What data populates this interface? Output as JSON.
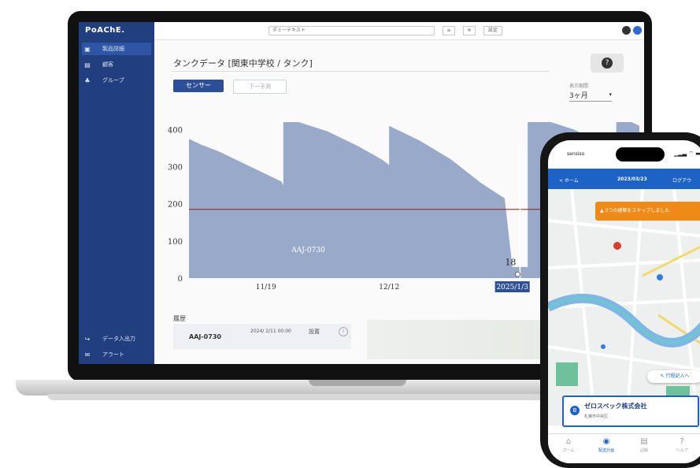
{
  "app": {
    "logo": "PoAChE.",
    "sidebar": {
      "items": [
        {
          "icon": "device-icon",
          "glyph": "▣",
          "label": "製品詳細",
          "active": true
        },
        {
          "icon": "building-icon",
          "glyph": "▤",
          "label": "顧客",
          "active": false
        },
        {
          "icon": "group-icon",
          "glyph": "♣",
          "label": "グループ",
          "active": false
        }
      ],
      "bottom": [
        {
          "icon": "import-icon",
          "glyph": "↪",
          "label": "データ入出力"
        },
        {
          "icon": "alert-icon",
          "glyph": "✉",
          "label": "アラート"
        }
      ]
    },
    "topbar": {
      "select": "ダミーテキスト",
      "buttons": [
        "≡",
        "※",
        "設定"
      ]
    },
    "title": "タンクデータ [関東中学校 / タンク]",
    "tabs": {
      "active": "センサー",
      "inactive": "下一予測"
    },
    "period": {
      "label": "表示期間",
      "value": "3ヶ月",
      "caret": "▾"
    },
    "history": {
      "label": "履歴",
      "row": {
        "id": "AAJ-0730",
        "date": "2024/ 2/11 00:00",
        "type": "設置",
        "info": "i"
      }
    }
  },
  "chart_data": {
    "type": "area",
    "y_ticks": [
      "400",
      "300",
      "200",
      "100",
      "0"
    ],
    "x_ticks": [
      "11/19",
      "12/12",
      "2025/1/3"
    ],
    "ylim": [
      0,
      420
    ],
    "threshold": 185,
    "series_label": "AAJ-0730",
    "cursor_value": "18",
    "points": [
      [
        0,
        375
      ],
      [
        3,
        360
      ],
      [
        8,
        340
      ],
      [
        14,
        310
      ],
      [
        20,
        280
      ],
      [
        24,
        260
      ],
      [
        24.5,
        250
      ],
      [
        24.5,
        430
      ],
      [
        28.5,
        430
      ],
      [
        36,
        395
      ],
      [
        44,
        355
      ],
      [
        50,
        320
      ],
      [
        52,
        305
      ],
      [
        52,
        410
      ],
      [
        60,
        370
      ],
      [
        68,
        320
      ],
      [
        76,
        255
      ],
      [
        82,
        215
      ],
      [
        84,
        30
      ],
      [
        88,
        30
      ],
      [
        88,
        430
      ],
      [
        94,
        430
      ],
      [
        100,
        400
      ],
      [
        106,
        370
      ],
      [
        110,
        345
      ],
      [
        111,
        330
      ],
      [
        111,
        430
      ],
      [
        112,
        430
      ],
      [
        115,
        420
      ],
      [
        117,
        410
      ]
    ],
    "x_range": [
      0,
      117
    ],
    "colors": {
      "area": "#99a9c9",
      "threshold": "#8b1a1a",
      "cursor": "#2d4f9a"
    }
  },
  "phone": {
    "time": "sensiso",
    "status": "▁▂▃ ⌔ ▬",
    "header": {
      "back": "< ホーム",
      "date": "2023/03/23",
      "logout": "ログアウ"
    },
    "alert": "▲  3つの建築をスキップしました",
    "edit": "✎  行程記入へ",
    "card": {
      "icon": "B",
      "title": "ゼロスペック株式会社",
      "subtitle": "札幌市中央区"
    },
    "tabs": [
      {
        "icon": "home-icon",
        "glyph": "⌂",
        "label": "ホーム",
        "active": false
      },
      {
        "icon": "location-icon",
        "glyph": "◉",
        "label": "配送計画",
        "active": true
      },
      {
        "icon": "document-icon",
        "glyph": "▤",
        "label": "記録",
        "active": false
      },
      {
        "icon": "help-icon",
        "glyph": "?",
        "label": "ヘルプ",
        "active": false
      }
    ]
  }
}
